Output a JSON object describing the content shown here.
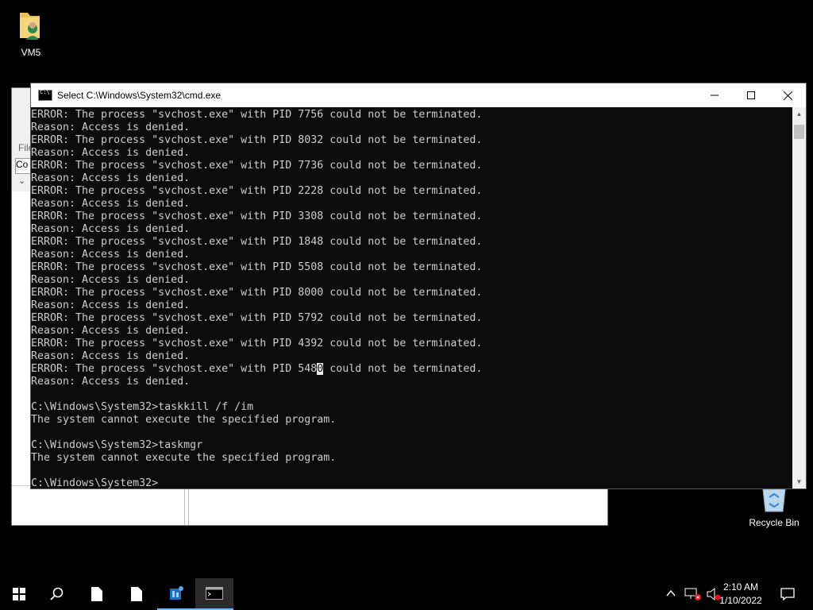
{
  "desktop": {
    "icons": [
      {
        "label": "VM5",
        "icon": "user-folder-icon"
      },
      {
        "label": "Recycle Bin",
        "icon": "recycle-bin-icon"
      }
    ]
  },
  "explorer": {
    "file_label": "File",
    "co_label": "Co"
  },
  "cmd": {
    "title": "Select C:\\Windows\\System32\\cmd.exe",
    "lines": [
      "ERROR: The process \"svchost.exe\" with PID 7756 could not be terminated.",
      "Reason: Access is denied.",
      "ERROR: The process \"svchost.exe\" with PID 8032 could not be terminated.",
      "Reason: Access is denied.",
      "ERROR: The process \"svchost.exe\" with PID 7736 could not be terminated.",
      "Reason: Access is denied.",
      "ERROR: The process \"svchost.exe\" with PID 2228 could not be terminated.",
      "Reason: Access is denied.",
      "ERROR: The process \"svchost.exe\" with PID 3308 could not be terminated.",
      "Reason: Access is denied.",
      "ERROR: The process \"svchost.exe\" with PID 1848 could not be terminated.",
      "Reason: Access is denied.",
      "ERROR: The process \"svchost.exe\" with PID 5508 could not be terminated.",
      "Reason: Access is denied.",
      "ERROR: The process \"svchost.exe\" with PID 8000 could not be terminated.",
      "Reason: Access is denied.",
      "ERROR: The process \"svchost.exe\" with PID 5792 could not be terminated.",
      "Reason: Access is denied.",
      "ERROR: The process \"svchost.exe\" with PID 4392 could not be terminated.",
      "Reason: Access is denied.",
      "ERROR: The process \"svchost.exe\" with PID 5480 could not be terminated.",
      "Reason: Access is denied.",
      "",
      "C:\\Windows\\System32>taskkill /f /im",
      "The system cannot execute the specified program.",
      "",
      "C:\\Windows\\System32>taskmgr",
      "The system cannot execute the specified program.",
      "",
      "C:\\Windows\\System32>"
    ],
    "selection": {
      "line": 20,
      "col": 45
    }
  },
  "taskbar": {
    "time": "2:10 AM",
    "date": "1/10/2022",
    "pinned": [
      "start-icon",
      "search-icon",
      "file-icon",
      "file-icon",
      "server-manager-icon",
      "cmd-icon"
    ]
  }
}
